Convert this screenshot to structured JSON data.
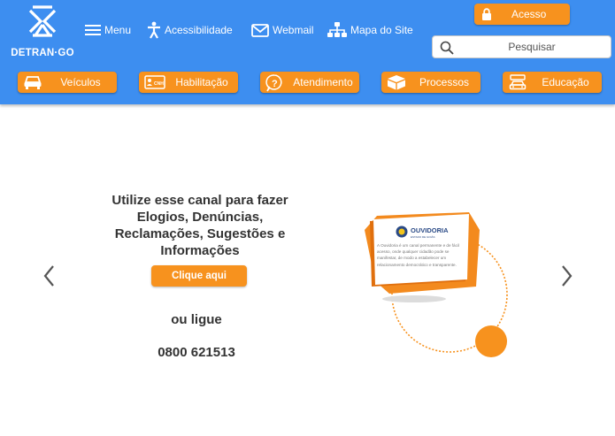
{
  "brand": {
    "name": "DETRAN·GO"
  },
  "topnav": {
    "menu": "Menu",
    "acessibilidade": "Acessibilidade",
    "webmail": "Webmail",
    "mapa": "Mapa do Site"
  },
  "acesso": {
    "label": "Acesso"
  },
  "search": {
    "placeholder": "Pesquisar"
  },
  "categories": [
    {
      "label": "Veículos",
      "icon": "car-icon"
    },
    {
      "label": "Habilitação",
      "icon": "cnh-card-icon"
    },
    {
      "label": "Atendimento",
      "icon": "question-bubble-icon"
    },
    {
      "label": "Processos",
      "icon": "box-icon"
    },
    {
      "label": "Educação",
      "icon": "car-sign-icon"
    }
  ],
  "carousel": {
    "headline": "Utilize esse canal para fazer Elogios, Denúncias, Reclamações, Sugestões e Informações",
    "cta": "Clique aqui",
    "or_call": "ou ligue",
    "phone": "0800 621513",
    "ouvidoria_title": "OUVIDORIA",
    "ouvidoria_sub": "ESTADO DE GOIÁS",
    "ouvidoria_text": "A Ouvidoria é um canal permanente e de fácil acesso, onde qualquer cidadão pode se manifestar, de modo a estabelecer um relacionamento democrático e transparente."
  },
  "colors": {
    "header": "#3d8ef0",
    "accent": "#f7921e",
    "text": "#333333"
  }
}
